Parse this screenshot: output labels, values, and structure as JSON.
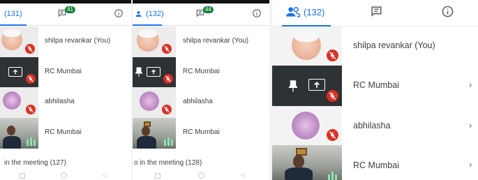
{
  "panels": [
    {
      "participants_tab_label": "(131)",
      "chat_badge": "41",
      "footer": "in the meeting (127)",
      "rows": [
        {
          "name": "shilpa revankar (You)",
          "avatar": "baby-photo",
          "muted": true
        },
        {
          "name": "RC Mumbai",
          "avatar": "screen-share",
          "muted": true
        },
        {
          "name": "abhilasha",
          "avatar": "girl-photo",
          "muted": true
        },
        {
          "name": "RC Mumbai",
          "avatar": "camera-video",
          "muted": false
        }
      ]
    },
    {
      "participants_tab_label": "(132)",
      "chat_badge": "44",
      "footer": "o in the meeting (128)",
      "rows": [
        {
          "name": "shilpa revankar (You)",
          "avatar": "baby-photo",
          "muted": true
        },
        {
          "name": "RC Mumbai",
          "avatar": "screen-share",
          "muted": true
        },
        {
          "name": "abhilasha",
          "avatar": "girl-photo",
          "muted": true
        },
        {
          "name": "RC Mumbai",
          "avatar": "camera-video",
          "muted": false
        }
      ]
    },
    {
      "participants_tab_label": "(132)",
      "rows": [
        {
          "name": "shilpa revankar (You)",
          "avatar": "baby-photo",
          "muted": true
        },
        {
          "name": "RC Mumbai",
          "avatar": "screen-share",
          "muted": true
        },
        {
          "name": "abhilasha",
          "avatar": "girl-photo",
          "muted": true
        },
        {
          "name": "RC Mumbai",
          "avatar": "camera-video",
          "muted": false
        }
      ]
    }
  ],
  "icons": {
    "participants": "people-icon",
    "chat": "chat-icon",
    "info": "info-icon",
    "mic_off": "mic-off-icon",
    "present": "present-to-all-icon",
    "pin": "pin-icon",
    "chevron": "chevron-right-icon",
    "audio_level": "audio-level-icon"
  },
  "colors": {
    "accent": "#1a73e8",
    "mute": "#d93025",
    "badge": "#188038"
  }
}
